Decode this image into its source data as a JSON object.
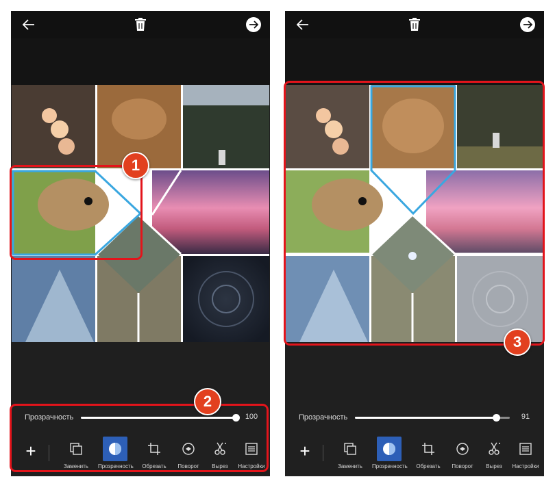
{
  "colors": {
    "highlight": "#e3141b",
    "badge": "#e2401f",
    "active_tool": "#2d5fb7",
    "selection": "#3aa7e0"
  },
  "topbar": {
    "back_icon": "arrow-left-icon",
    "trash_icon": "trash-icon",
    "next_icon": "arrow-right-circle-icon"
  },
  "screens": [
    {
      "slider": {
        "label": "Прозрачность",
        "value": "100",
        "level_percent": 100
      },
      "tools": [
        {
          "label": "Заменить",
          "icon": "replace-icon"
        },
        {
          "label": "Прозрачность",
          "icon": "transparency-icon"
        },
        {
          "label": "Обрезать",
          "icon": "crop-icon"
        },
        {
          "label": "Поворот",
          "icon": "rotate-icon"
        },
        {
          "label": "Вырез",
          "icon": "cutout-icon"
        },
        {
          "label": "Настройки",
          "icon": "settings-icon"
        }
      ],
      "add_button": "+"
    },
    {
      "slider": {
        "label": "Прозрачность",
        "value": "91",
        "level_percent": 91
      },
      "tools": [
        {
          "label": "Заменить",
          "icon": "replace-icon"
        },
        {
          "label": "Прозрачность",
          "icon": "transparency-icon"
        },
        {
          "label": "Обрезать",
          "icon": "crop-icon"
        },
        {
          "label": "Поворот",
          "icon": "rotate-icon"
        },
        {
          "label": "Вырез",
          "icon": "cutout-icon"
        },
        {
          "label": "Настройки",
          "icon": "settings-icon"
        }
      ],
      "add_button": "+"
    }
  ],
  "badges": [
    "1",
    "2",
    "3"
  ]
}
